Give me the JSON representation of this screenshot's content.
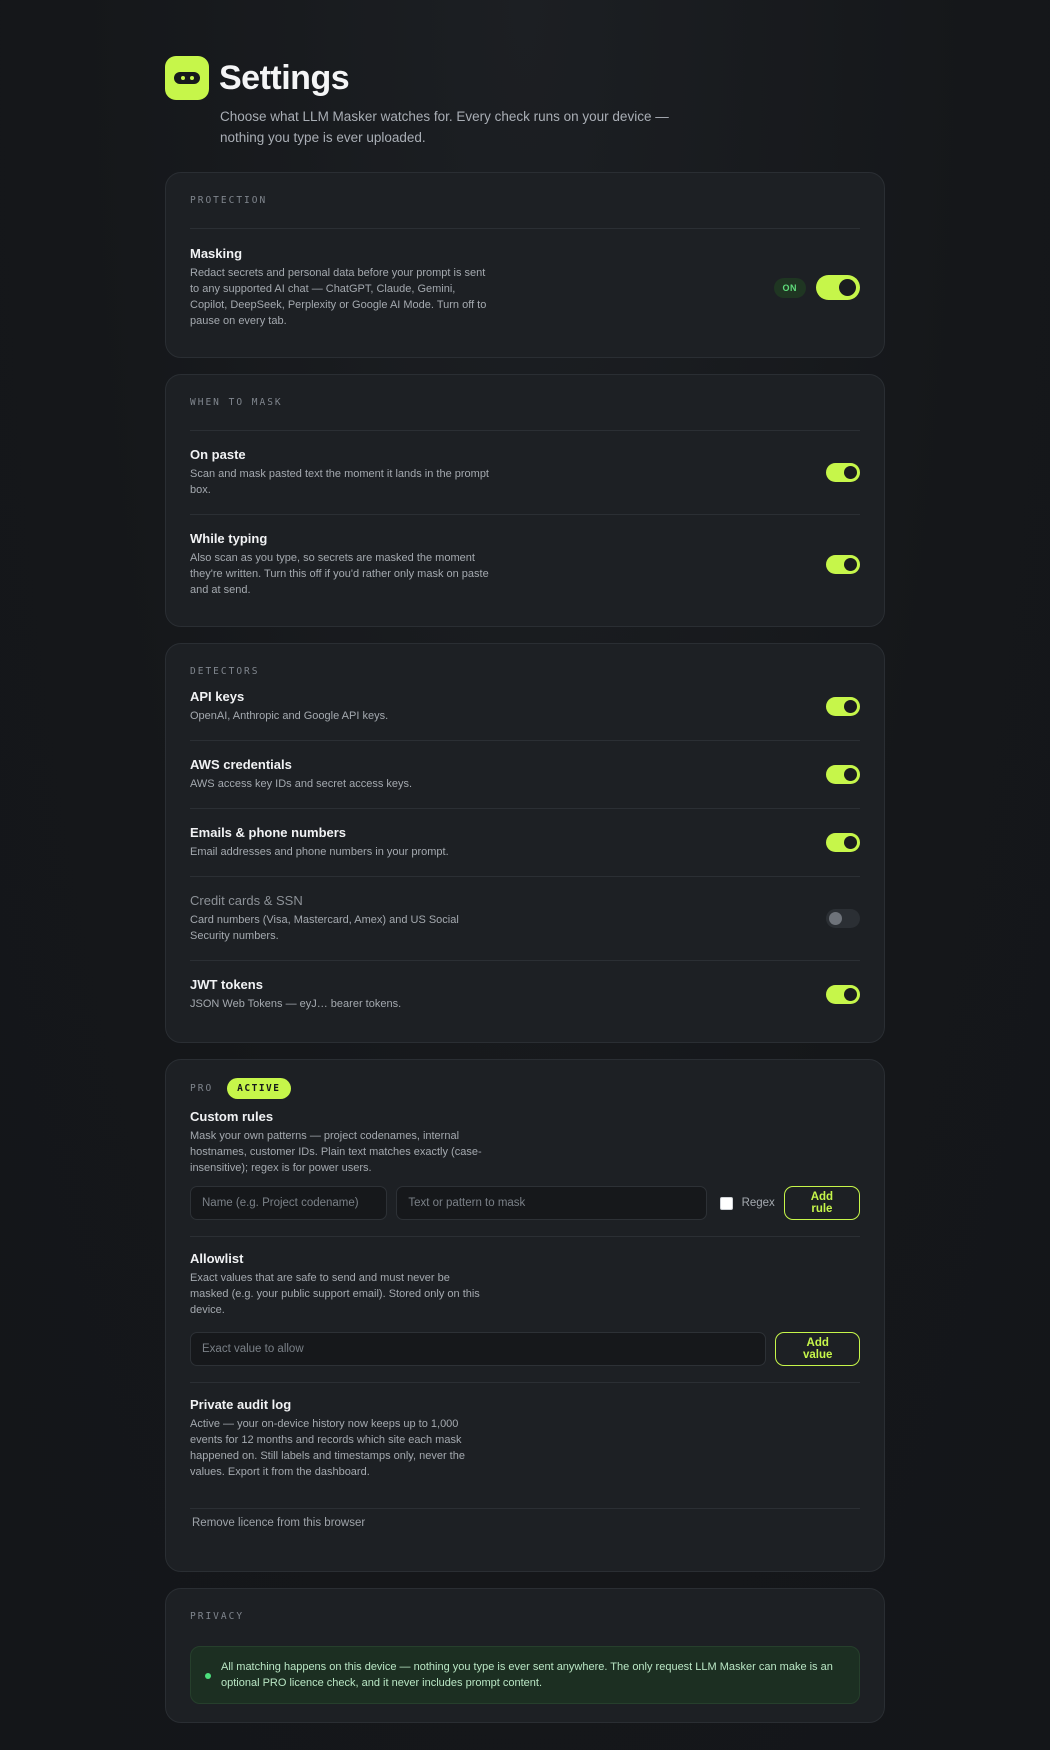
{
  "header": {
    "title": "Settings",
    "subtitle": "Choose what LLM Masker watches for. Every check runs on your device — nothing you type is ever uploaded."
  },
  "protection": {
    "label": "PROTECTION",
    "masking": {
      "title": "Masking",
      "desc": "Redact secrets and personal data before your prompt is sent to any supported AI chat — ChatGPT, Claude, Gemini, Copilot, DeepSeek, Perplexity or Google AI Mode. Turn off to pause on every tab.",
      "status": "ON",
      "enabled": true
    }
  },
  "when_to_mask": {
    "label": "WHEN TO MASK",
    "items": [
      {
        "title": "On paste",
        "desc": "Scan and mask pasted text the moment it lands in the prompt box.",
        "enabled": true
      },
      {
        "title": "While typing",
        "desc": "Also scan as you type, so secrets are masked the moment they're written. Turn this off if you'd rather only mask on paste and at send.",
        "enabled": true
      }
    ]
  },
  "detectors": {
    "label": "DETECTORS",
    "items": [
      {
        "title": "API keys",
        "desc": "OpenAI, Anthropic and Google API keys.",
        "enabled": true
      },
      {
        "title": "AWS credentials",
        "desc": "AWS access key IDs and secret access keys.",
        "enabled": true
      },
      {
        "title": "Emails & phone numbers",
        "desc": "Email addresses and phone numbers in your prompt.",
        "enabled": true
      },
      {
        "title": "Credit cards & SSN",
        "desc": "Card numbers (Visa, Mastercard, Amex) and US Social Security numbers.",
        "enabled": false
      },
      {
        "title": "JWT tokens",
        "desc": "JSON Web Tokens — eyJ… bearer tokens.",
        "enabled": true
      }
    ]
  },
  "pro": {
    "label": "PRO",
    "badge": "ACTIVE",
    "custom_rules": {
      "title": "Custom rules",
      "desc": "Mask your own patterns — project codenames, internal hostnames, customer IDs. Plain text matches exactly (case-insensitive); regex is for power users.",
      "name_placeholder": "Name (e.g. Project codename)",
      "pattern_placeholder": "Text or pattern to mask",
      "regex_label": "Regex",
      "add_label": "Add rule"
    },
    "allowlist": {
      "title": "Allowlist",
      "desc": "Exact values that are safe to send and must never be masked (e.g. your public support email). Stored only on this device.",
      "placeholder": "Exact value to allow",
      "add_label": "Add value"
    },
    "audit_log": {
      "title": "Private audit log",
      "desc": "Active — your on-device history now keeps up to 1,000 events for 12 months and records which site each mask happened on. Still labels and timestamps only, never the values. Export it from the dashboard."
    },
    "remove_licence": "Remove licence from this browser"
  },
  "privacy": {
    "label": "PRIVACY",
    "note": "All matching happens on this device — nothing you type is ever sent anywhere. The only request LLM Masker can make is an optional PRO licence check, and it never includes prompt content."
  },
  "colors": {
    "accent": "#c6f64a",
    "background": "#16181b",
    "card": "#1d2024",
    "success": "#4be07c"
  }
}
